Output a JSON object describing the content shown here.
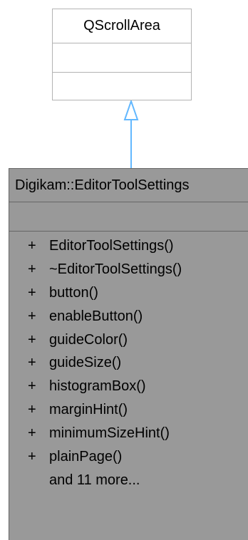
{
  "parent_class": {
    "name": "QScrollArea"
  },
  "child_class": {
    "name": "Digikam::EditorToolSettings",
    "methods": [
      {
        "visibility": "+",
        "signature": "EditorToolSettings()"
      },
      {
        "visibility": "+",
        "signature": "~EditorToolSettings()"
      },
      {
        "visibility": "+",
        "signature": "button()"
      },
      {
        "visibility": "+",
        "signature": "enableButton()"
      },
      {
        "visibility": "+",
        "signature": "guideColor()"
      },
      {
        "visibility": "+",
        "signature": "guideSize()"
      },
      {
        "visibility": "+",
        "signature": "histogramBox()"
      },
      {
        "visibility": "+",
        "signature": "marginHint()"
      },
      {
        "visibility": "+",
        "signature": "minimumSizeHint()"
      },
      {
        "visibility": "+",
        "signature": "plainPage()"
      },
      {
        "visibility": "",
        "signature": "and 11 more..."
      }
    ]
  },
  "colors": {
    "arrow": "#63b8ff",
    "child_fill": "#999999",
    "parent_border": "#b3b3b3"
  }
}
